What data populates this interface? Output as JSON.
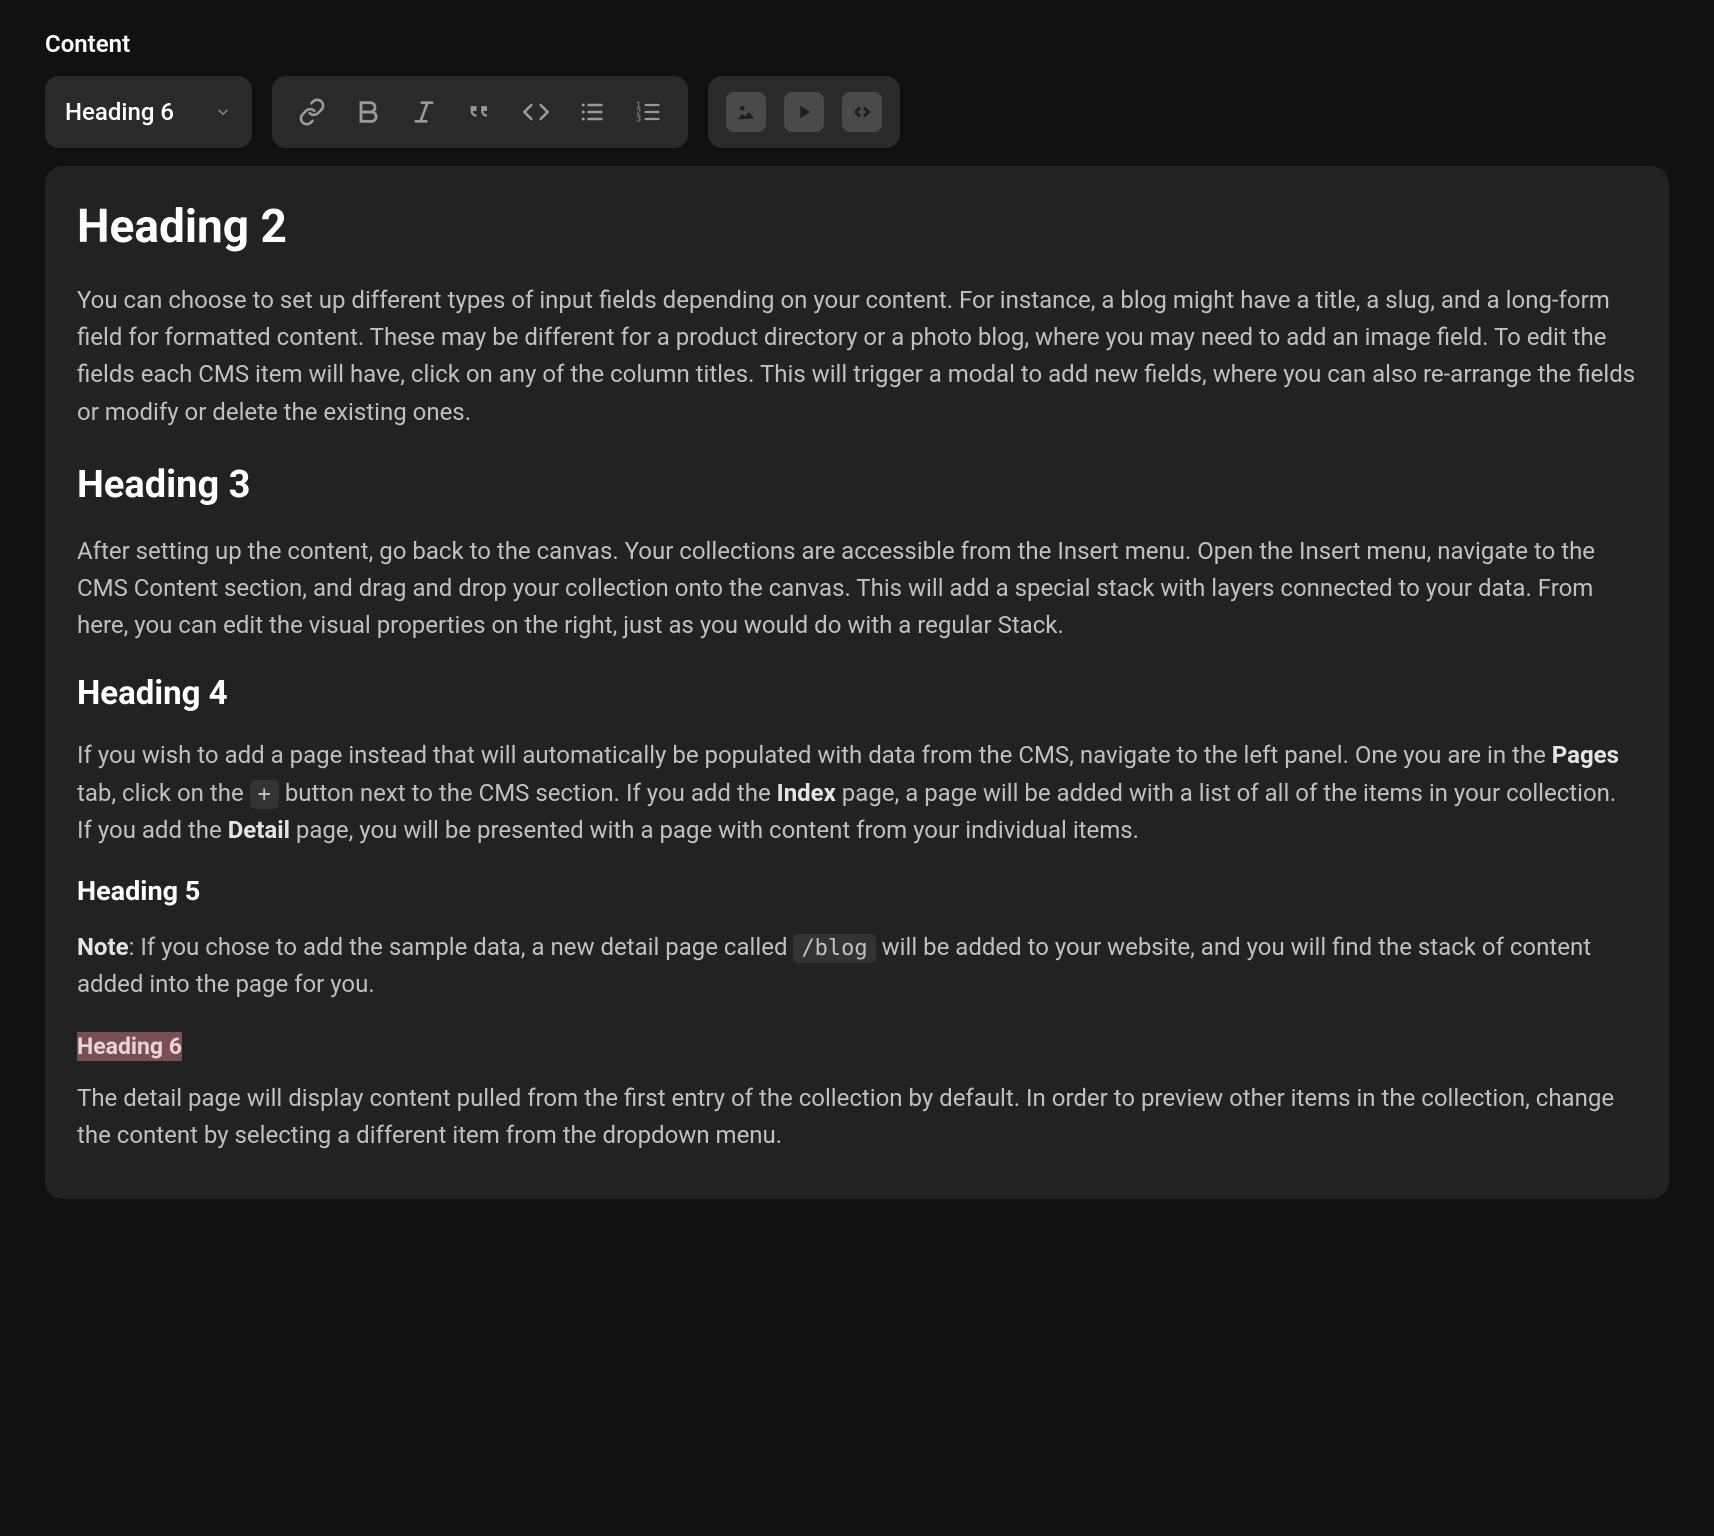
{
  "label": "Content",
  "toolbar": {
    "heading_select": "Heading 6"
  },
  "editor": {
    "h2": "Heading 2",
    "p1": "You can choose to set up different types of input fields depending on your content. For instance, a blog might have a title, a slug, and a long-form field for formatted content. These may be different for a product directory or a photo blog, where you may need to add an image field. To edit the fields each CMS item will have, click on any of the column titles. This will trigger a modal to add new fields, where you can also re-arrange the fields or modify or delete the existing ones.",
    "h3": "Heading 3",
    "p2": "After setting up the content, go back to the canvas. Your collections are accessible from the Insert menu. Open the Insert menu, navigate to the CMS Content section, and drag and drop your collection onto the canvas. This will add a special stack with layers connected to your data. From here, you can edit the visual properties on the right, just as you would do with a regular Stack.",
    "h4": "Heading 4",
    "p3a": "If you wish to add a page instead that will automatically be populated with data from the CMS, navigate to the left panel. One you are in the ",
    "p3_pages": "Pages",
    "p3b": " tab, click on the ",
    "p3_plus": "+",
    "p3c": " button next to the CMS section. If you add the ",
    "p3_index": "Index",
    "p3d": " page, a page will be added with a list of all of the items in your collection. If you add the ",
    "p3_detail": "Detail",
    "p3e": " page, you will be presented with a page with content from your individual items.",
    "h5": "Heading 5",
    "p4_note": "Note",
    "p4a": ": If you chose to add the sample data, a new detail page called ",
    "p4_code": "/blog",
    "p4b": " will be added to your website, and you will find the stack of content added into the page for you.",
    "h6": "Heading 6",
    "p5": "The detail page will display content pulled from the first entry of the collection by default. In order to preview other items in the collection, change the content by selecting a different item from the dropdown menu."
  }
}
